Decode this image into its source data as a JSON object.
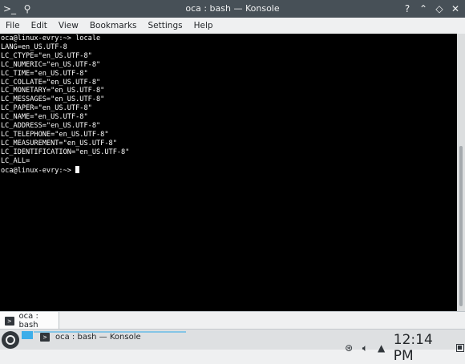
{
  "window": {
    "title": "oca : bash — Konsole",
    "buttons": {
      "help": "?",
      "minimize": "⌃",
      "restore": "◇",
      "close": "✕"
    }
  },
  "menubar": {
    "items": [
      "File",
      "Edit",
      "View",
      "Bookmarks",
      "Settings",
      "Help"
    ]
  },
  "terminal": {
    "lines": [
      "oca@linux-evry:~> locale",
      "LANG=en_US.UTF-8",
      "LC_CTYPE=\"en_US.UTF-8\"",
      "LC_NUMERIC=\"en_US.UTF-8\"",
      "LC_TIME=\"en_US.UTF-8\"",
      "LC_COLLATE=\"en_US.UTF-8\"",
      "LC_MONETARY=\"en_US.UTF-8\"",
      "LC_MESSAGES=\"en_US.UTF-8\"",
      "LC_PAPER=\"en_US.UTF-8\"",
      "LC_NAME=\"en_US.UTF-8\"",
      "LC_ADDRESS=\"en_US.UTF-8\"",
      "LC_TELEPHONE=\"en_US.UTF-8\"",
      "LC_MEASUREMENT=\"en_US.UTF-8\"",
      "LC_IDENTIFICATION=\"en_US.UTF-8\"",
      "LC_ALL="
    ],
    "prompt": "oca@linux-evry:~> "
  },
  "tab": {
    "label": "oca : bash",
    "icon": "terminal-icon"
  },
  "taskbar": {
    "task_label": "oca : bash — Konsole",
    "clock": "12:14 PM",
    "tray_icons": [
      "updater-icon",
      "volume-icon",
      "expand-up-icon",
      "show-desktop-icon"
    ],
    "accent": "#3daee9"
  },
  "colors": {
    "titlebar": "#475057",
    "terminal_bg": "#000000",
    "terminal_fg": "#fcfcfc"
  }
}
